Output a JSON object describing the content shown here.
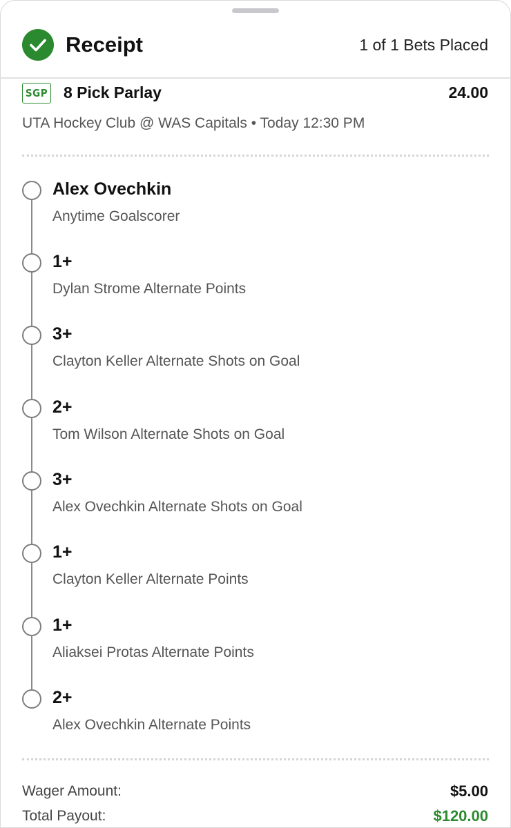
{
  "header": {
    "title": "Receipt",
    "bets_placed": "1 of 1 Bets Placed",
    "check_icon": "check-circle-icon",
    "accent_color": "#2b8a2f"
  },
  "bet": {
    "badge": "SGP",
    "title": "8 Pick Parlay",
    "odds": "24.00",
    "event": "UTA Hockey Club @ WAS Capitals • Today 12:30 PM"
  },
  "legs": [
    {
      "selection": "Alex Ovechkin",
      "market": "Anytime Goalscorer"
    },
    {
      "selection": "1+",
      "market": "Dylan Strome Alternate Points"
    },
    {
      "selection": "3+",
      "market": "Clayton Keller Alternate Shots on Goal"
    },
    {
      "selection": "2+",
      "market": "Tom Wilson Alternate Shots on Goal"
    },
    {
      "selection": "3+",
      "market": "Alex Ovechkin Alternate Shots on Goal"
    },
    {
      "selection": "1+",
      "market": "Clayton Keller Alternate Points"
    },
    {
      "selection": "1+",
      "market": "Aliaksei Protas Alternate Points"
    },
    {
      "selection": "2+",
      "market": "Alex Ovechkin Alternate Points"
    }
  ],
  "summary": {
    "wager_label": "Wager Amount:",
    "wager_value": "$5.00",
    "payout_label": "Total Payout:",
    "payout_value": "$120.00"
  }
}
